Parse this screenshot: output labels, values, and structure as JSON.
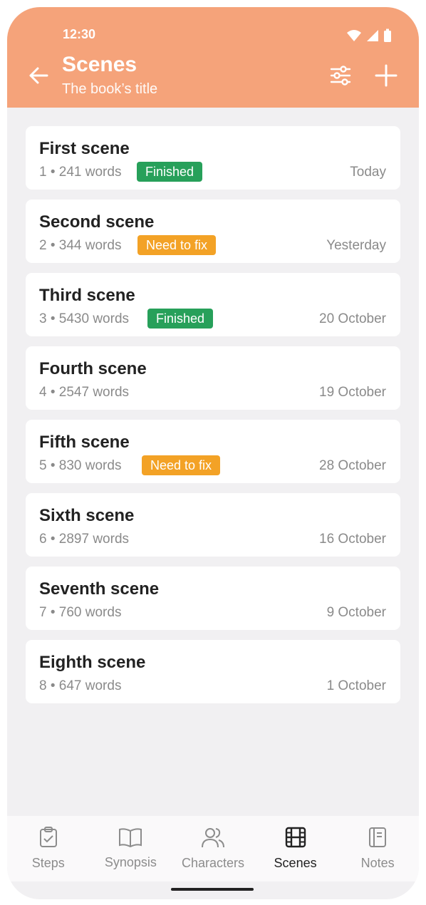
{
  "status_bar": {
    "time": "12:30"
  },
  "header": {
    "title": "Scenes",
    "subtitle": "The book’s title"
  },
  "scenes": [
    {
      "title": "First scene",
      "meta": "1 • 241 words",
      "badge": "Finished",
      "badge_type": "green",
      "date": "Today"
    },
    {
      "title": "Second scene",
      "meta": "2 • 344 words",
      "badge": "Need to fix",
      "badge_type": "orange",
      "date": "Yesterday"
    },
    {
      "title": "Third scene",
      "meta": "3 • 5430 words",
      "badge": "Finished",
      "badge_type": "green",
      "date": "20 October"
    },
    {
      "title": "Fourth scene",
      "meta": "4 • 2547 words",
      "badge": "",
      "badge_type": "",
      "date": "19 October"
    },
    {
      "title": "Fifth scene",
      "meta": "5 • 830 words",
      "badge": "Need to fix",
      "badge_type": "orange",
      "date": "28 October"
    },
    {
      "title": "Sixth scene",
      "meta": "6 • 2897 words",
      "badge": "",
      "badge_type": "",
      "date": "16 October"
    },
    {
      "title": "Seventh scene",
      "meta": "7 • 760 words",
      "badge": "",
      "badge_type": "",
      "date": "9 October"
    },
    {
      "title": "Eighth scene",
      "meta": "8 • 647 words",
      "badge": "",
      "badge_type": "",
      "date": "1 October"
    }
  ],
  "bottom_nav": [
    {
      "label": "Steps",
      "icon": "clipboard-check-icon",
      "active": false
    },
    {
      "label": "Synopsis",
      "icon": "book-icon",
      "active": false
    },
    {
      "label": "Characters",
      "icon": "users-icon",
      "active": false
    },
    {
      "label": "Scenes",
      "icon": "film-icon",
      "active": true
    },
    {
      "label": "Notes",
      "icon": "notebook-icon",
      "active": false
    }
  ],
  "colors": {
    "header": "#f5a37a",
    "finished": "#27a05a",
    "need_to_fix": "#f3a226"
  }
}
